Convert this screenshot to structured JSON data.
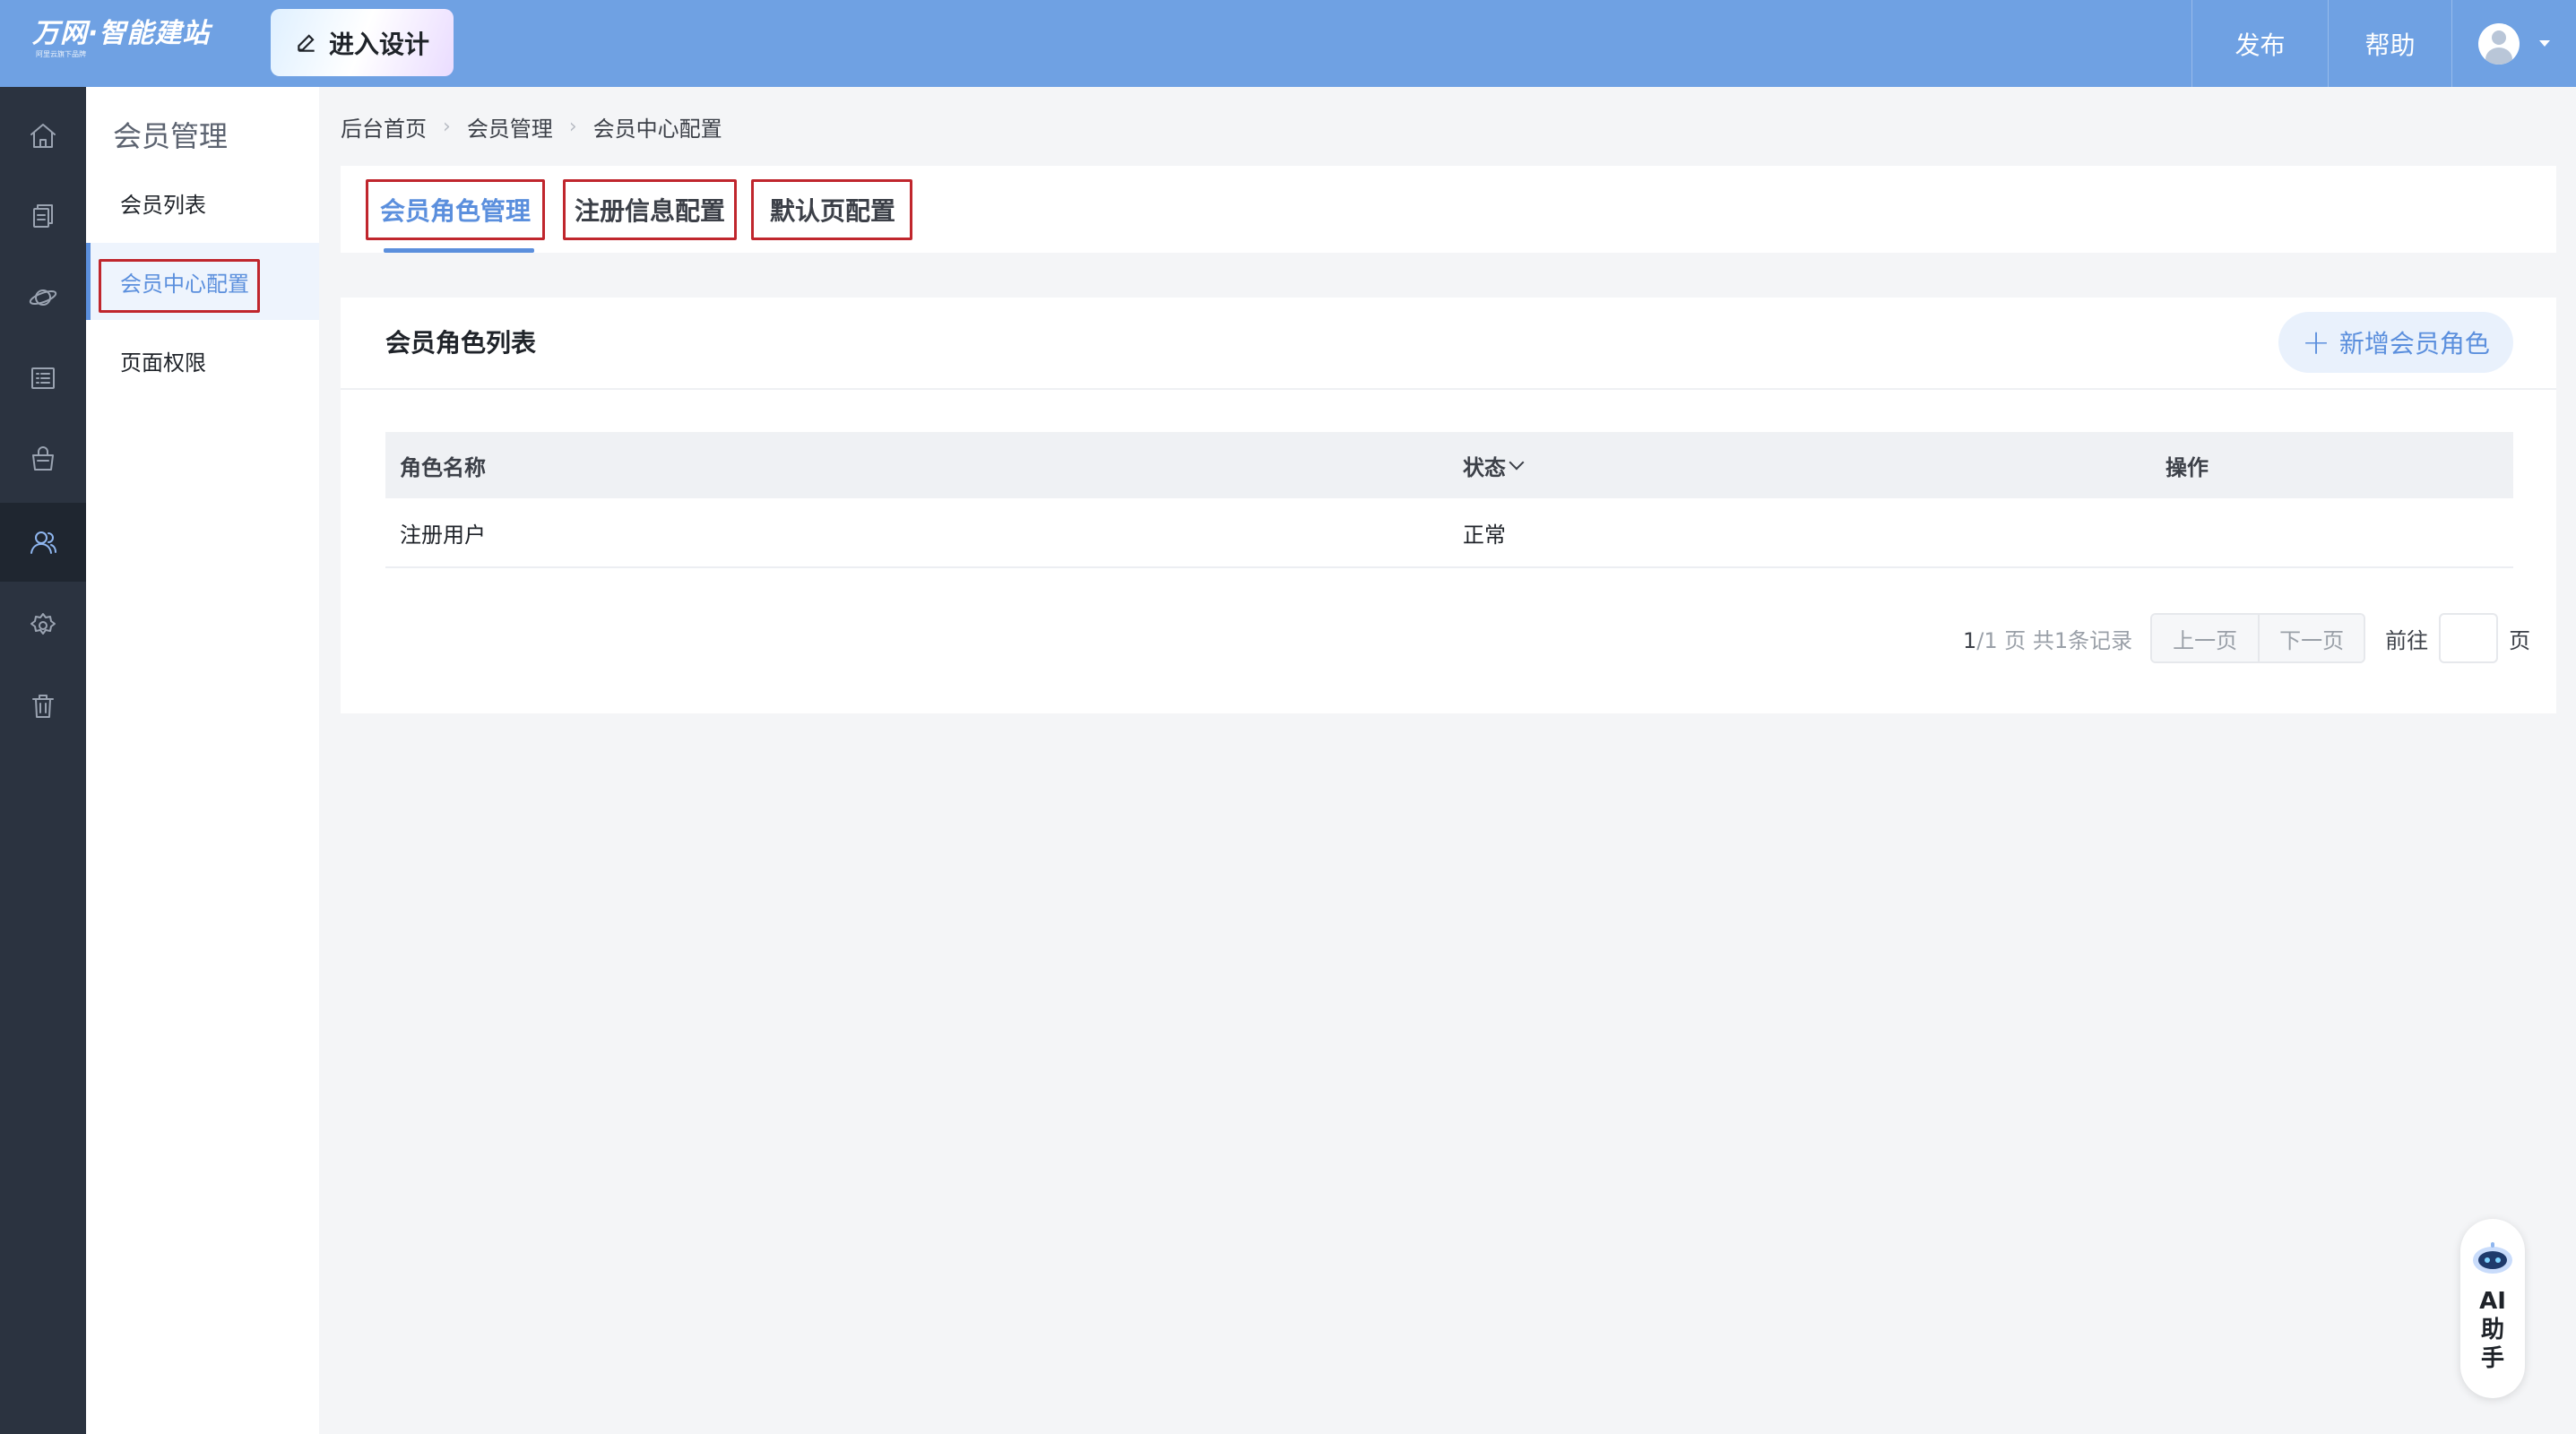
{
  "topbar": {
    "logo_text": "万网·智能建站",
    "logo_sub": "阿里云旗下品牌",
    "design_button": "进入设计",
    "publish": "发布",
    "help": "帮助"
  },
  "rail": {
    "items": [
      "home-icon",
      "pages-icon",
      "planet-icon",
      "list-icon",
      "bag-icon",
      "member-icon",
      "gear-icon",
      "trash-icon"
    ],
    "active_index": 5
  },
  "subnav": {
    "title": "会员管理",
    "items": [
      {
        "label": "会员列表"
      },
      {
        "label": "会员中心配置"
      },
      {
        "label": "页面权限"
      }
    ],
    "active_index": 1
  },
  "breadcrumb": [
    "后台首页",
    "会员管理",
    "会员中心配置"
  ],
  "tabs": [
    {
      "label": "会员角色管理"
    },
    {
      "label": "注册信息配置"
    },
    {
      "label": "默认页配置"
    }
  ],
  "active_tab": 0,
  "card": {
    "title": "会员角色列表",
    "add_button": "新增会员角色"
  },
  "table": {
    "headers": [
      "角色名称",
      "状态",
      "操作"
    ],
    "rows": [
      {
        "name": "注册用户",
        "status": "正常",
        "actions": ""
      }
    ]
  },
  "pagination": {
    "current": "1",
    "info_suffix": "/1 页 共1条记录",
    "prev": "上一页",
    "next": "下一页",
    "goto_label": "前往",
    "page_suffix": "页",
    "goto_value": ""
  },
  "ai_assistant": {
    "label": "AI助手"
  },
  "colors": {
    "topbar": "#6fa1e3",
    "accent": "#5b8fdd",
    "rail": "#2b3340",
    "highlight_box": "#c0262d"
  }
}
